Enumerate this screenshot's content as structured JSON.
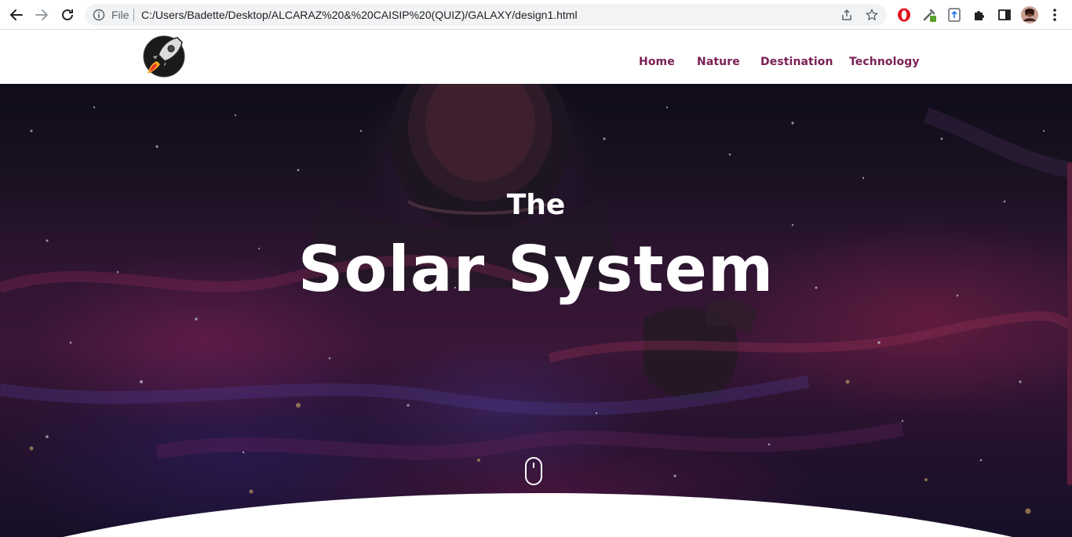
{
  "browser": {
    "file_label": "File",
    "url": "C:/Users/Badette/Desktop/ALCARAZ%20&%20CAISIP%20(QUIZ)/GALAXY/design1.html",
    "icons": [
      "back-icon",
      "forward-icon",
      "reload-icon",
      "info-icon",
      "share-icon",
      "star-icon",
      "opera-icon",
      "eyedropper-icon",
      "upload-icon",
      "puzzle-icon",
      "sidepanel-icon",
      "profile-avatar",
      "more-icon"
    ]
  },
  "nav": {
    "logo": "rocket-icon",
    "items": [
      {
        "label": "Home"
      },
      {
        "label": "Nature"
      },
      {
        "label": "Destination"
      },
      {
        "label": "Technology"
      }
    ],
    "color": "#7a1f55"
  },
  "hero": {
    "kicker": "The",
    "title": "Solar System",
    "scroll_icon": "mouse-scroll-icon"
  }
}
